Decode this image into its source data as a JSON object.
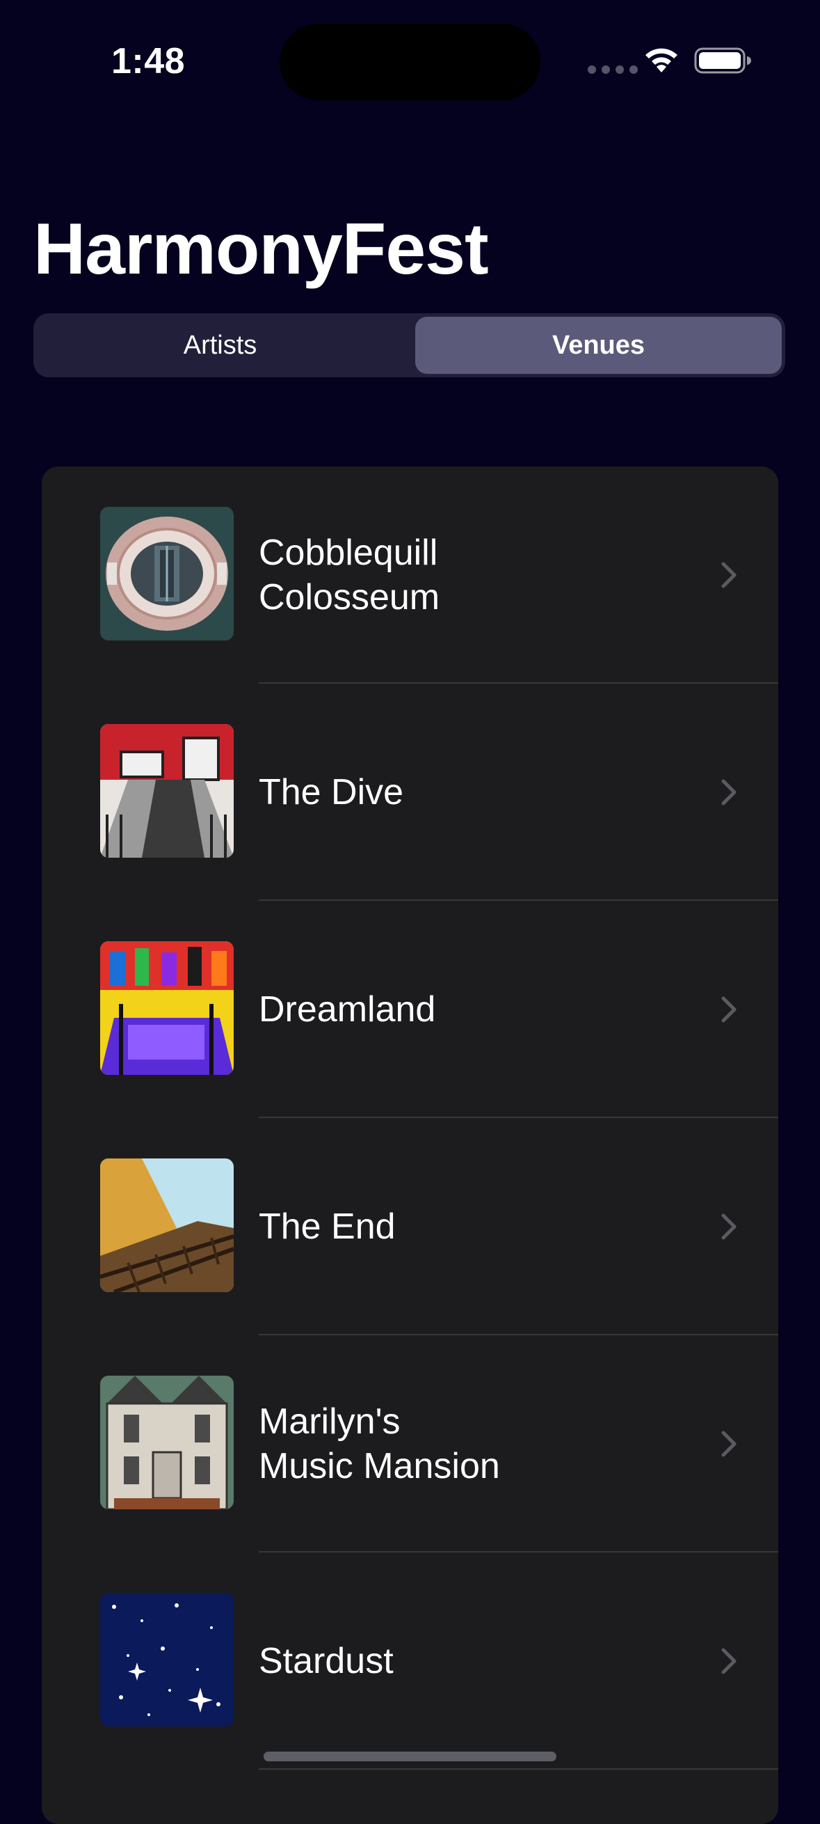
{
  "status_bar": {
    "time": "1:48",
    "icons": [
      "cellular-signal-icon",
      "wifi-icon",
      "battery-icon"
    ]
  },
  "header": {
    "title": "HarmonyFest"
  },
  "segmented_control": {
    "segments": [
      {
        "label": "Artists",
        "selected": false
      },
      {
        "label": "Venues",
        "selected": true
      }
    ]
  },
  "venues": [
    {
      "name": "Cobblequill\nColosseum",
      "image": "stadium-aerial-thumbnail"
    },
    {
      "name": "The Dive",
      "image": "bar-interior-thumbnail"
    },
    {
      "name": "Dreamland",
      "image": "colorful-club-thumbnail"
    },
    {
      "name": "The End",
      "image": "railroad-tracks-thumbnail"
    },
    {
      "name": "Marilyn's\nMusic Mansion",
      "image": "mansion-facade-thumbnail"
    },
    {
      "name": "Stardust",
      "image": "starry-sky-thumbnail"
    }
  ],
  "colors": {
    "background": "#04021f",
    "card": "#1c1c1e",
    "segment_track": "#211f3a",
    "segment_selected": "#5c5a7a",
    "separator": "#38383a",
    "chevron": "#5a5a60"
  }
}
